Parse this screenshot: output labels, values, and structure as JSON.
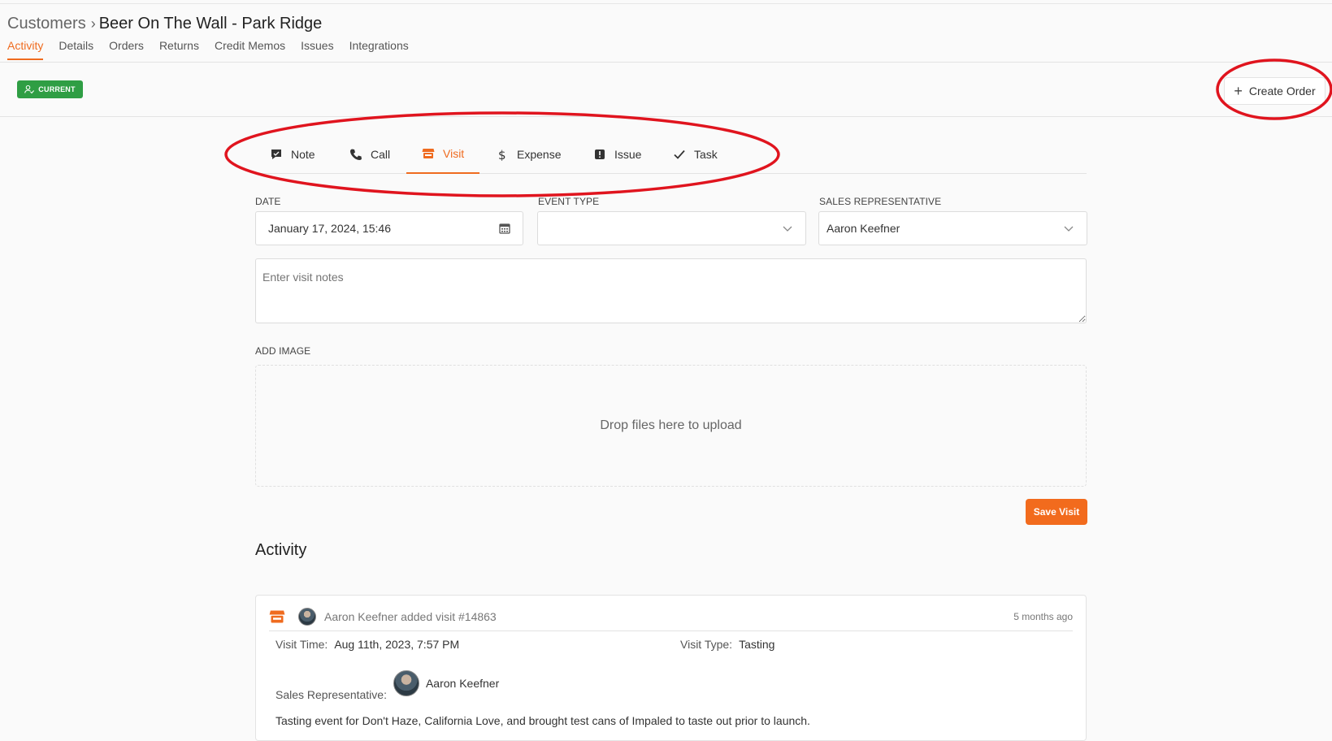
{
  "breadcrumb": {
    "root": "Customers",
    "separator": "›",
    "current": "Beer On The Wall - Park Ridge"
  },
  "tabs": [
    {
      "label": "Activity",
      "active": true
    },
    {
      "label": "Details"
    },
    {
      "label": "Orders"
    },
    {
      "label": "Returns"
    },
    {
      "label": "Credit Memos"
    },
    {
      "label": "Issues"
    },
    {
      "label": "Integrations"
    }
  ],
  "status_badge": {
    "label": "CURRENT",
    "color": "#2f9e44",
    "icon": "user-check-icon"
  },
  "create_order": {
    "label": "Create Order",
    "icon": "plus-icon"
  },
  "activity_types": [
    {
      "label": "Note",
      "icon": "note-icon"
    },
    {
      "label": "Call",
      "icon": "phone-icon"
    },
    {
      "label": "Visit",
      "icon": "store-icon",
      "active": true
    },
    {
      "label": "Expense",
      "icon": "dollar-icon"
    },
    {
      "label": "Issue",
      "icon": "alert-icon"
    },
    {
      "label": "Task",
      "icon": "check-icon"
    }
  ],
  "form": {
    "date_label": "DATE",
    "date_value": "January 17, 2024, 15:46",
    "event_type_label": "EVENT TYPE",
    "event_type_value": "",
    "sales_rep_label": "SALES REPRESENTATIVE",
    "sales_rep_value": "Aaron Keefner",
    "notes_placeholder": "Enter visit notes",
    "add_image_label": "ADD IMAGE",
    "dropzone_text": "Drop files here to upload",
    "save_label": "Save Visit"
  },
  "activity": {
    "heading": "Activity",
    "items": [
      {
        "author_line": "Aaron Keefner added visit #14863",
        "time_ago": "5 months ago",
        "visit_time_label": "Visit Time:",
        "visit_time": "Aug 11th, 2023, 7:57 PM",
        "visit_type_label": "Visit Type:",
        "visit_type": "Tasting",
        "sales_rep_label": "Sales Representative:",
        "sales_rep": "Aaron Keefner",
        "notes": "Tasting event for Don't Haze, California Love, and brought test cans of Impaled to taste out prior to launch."
      }
    ]
  },
  "colors": {
    "accent": "#ef6b1f",
    "success": "#2f9e44",
    "annotation": "#e0141e"
  }
}
